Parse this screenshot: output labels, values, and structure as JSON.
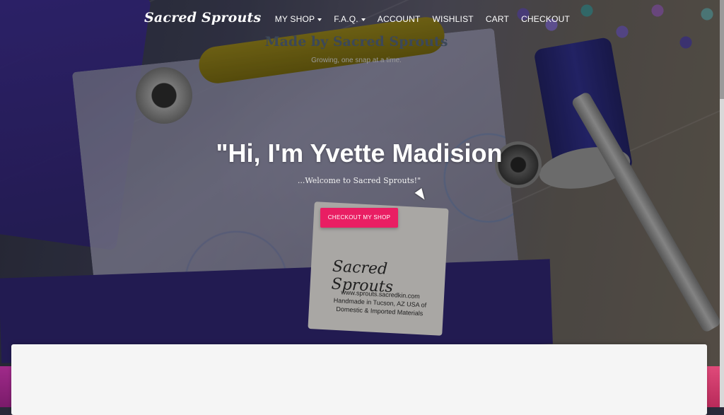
{
  "brand": {
    "name": "Sacred Sprouts"
  },
  "nav": {
    "items": [
      {
        "label": "MY SHOP",
        "dropdown": true
      },
      {
        "label": "F.A.Q.",
        "dropdown": true
      },
      {
        "label": "ACCOUNT",
        "dropdown": false
      },
      {
        "label": "WISHLIST",
        "dropdown": false
      },
      {
        "label": "CART",
        "dropdown": false
      },
      {
        "label": "CHECKOUT",
        "dropdown": false
      }
    ]
  },
  "hero": {
    "title": "\"Hi, I'm Yvette Madision",
    "subtitle": "...Welcome to Sacred Sprouts!\"",
    "cta_label": "CHECKOUT MY SHOP",
    "label_brand": "Sacred Sprouts",
    "label_text": "www.sprouts.sacredkin.com Handmade in Tucson, AZ USA of Domestic & Imported Materials"
  },
  "section": {
    "title": "Made by Sacred Sprouts",
    "subtitle": "Growing, one snap at a time."
  },
  "colors": {
    "accent": "#e91e63",
    "card_bg": "#f5f5f5",
    "title_text": "#3c4858"
  },
  "icons": {
    "caret": "chevron-down-icon",
    "cursor": "mouse-pointer-icon"
  }
}
